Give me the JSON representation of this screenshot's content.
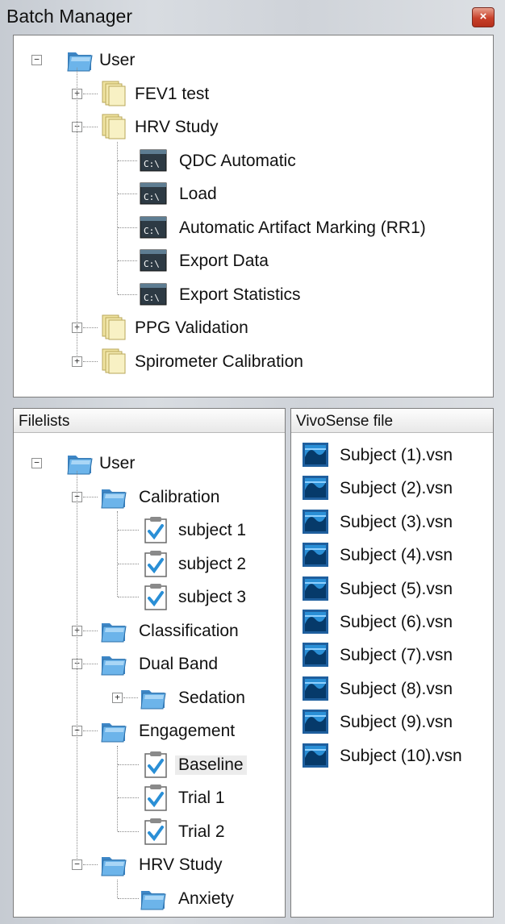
{
  "window": {
    "title": "Batch Manager",
    "close_glyph": "×"
  },
  "batches": {
    "root": "User",
    "items": [
      {
        "label": "FEV1 test",
        "expanded": false
      },
      {
        "label": "HRV Study",
        "expanded": true,
        "children": [
          "QDC Automatic",
          "Load",
          "Automatic Artifact Marking (RR1)",
          "Export Data",
          "Export Statistics"
        ]
      },
      {
        "label": "PPG Validation",
        "expanded": false
      },
      {
        "label": "Spirometer Calibration",
        "expanded": false
      }
    ]
  },
  "filelists": {
    "header": "Filelists",
    "root": "User",
    "nodes": [
      {
        "label": "Calibration",
        "kind": "folder",
        "children": [
          "subject 1",
          "subject 2",
          "subject 3"
        ]
      },
      {
        "label": "Classification",
        "kind": "folder"
      },
      {
        "label": "Dual Band",
        "kind": "folder",
        "subfolder": "Sedation"
      },
      {
        "label": "Engagement",
        "kind": "folder",
        "children": [
          "Baseline",
          "Trial 1",
          "Trial 2"
        ],
        "selected_child": "Baseline"
      },
      {
        "label": "HRV Study",
        "kind": "folder",
        "subfolder": "Anxiety"
      }
    ]
  },
  "files": {
    "header": "VivoSense file",
    "items": [
      "Subject (1).vsn",
      "Subject (2).vsn",
      "Subject (3).vsn",
      "Subject (4).vsn",
      "Subject (5).vsn",
      "Subject (6).vsn",
      "Subject (7).vsn",
      "Subject (8).vsn",
      "Subject (9).vsn",
      "Subject (10).vsn"
    ]
  },
  "icons": {
    "folder": "folder-icon",
    "batch": "batch-stack-icon",
    "command": "command-prompt-icon",
    "checklist": "checklist-icon",
    "vsn": "vsn-file-icon",
    "expand": "expand-plus-icon",
    "collapse": "collapse-minus-icon"
  },
  "colors": {
    "accent_check": "#2a8fd6",
    "folder_blue": "#5aa6e0",
    "batch_yellow": "#f1e7a4"
  }
}
